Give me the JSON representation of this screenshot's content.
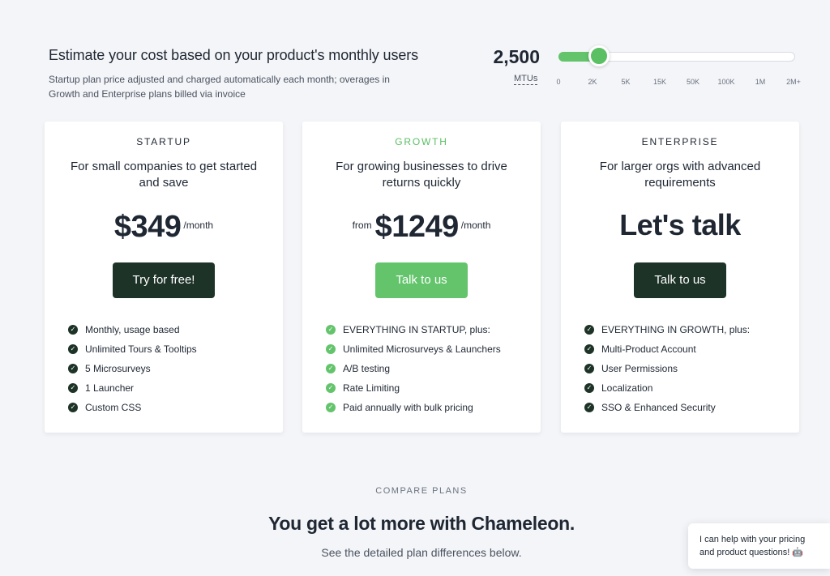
{
  "estimator": {
    "title": "Estimate your cost based on your product's monthly users",
    "subtitle": "Startup plan price adjusted and charged automatically each month; overages in Growth and Enterprise plans billed via invoice",
    "mtu_value": "2,500",
    "mtu_unit": "MTUs",
    "slider_fraction": 0.17,
    "ticks": [
      "0",
      "2K",
      "5K",
      "15K",
      "50K",
      "100K",
      "1M",
      "2M+"
    ]
  },
  "plans": [
    {
      "name": "STARTUP",
      "description": "For small companies to get started and save",
      "price_prefix": "",
      "price": "$349",
      "price_suffix": "/month",
      "cta": "Try for free!",
      "features": [
        "Monthly, usage based",
        "Unlimited Tours & Tooltips",
        "5 Microsurveys",
        "1 Launcher",
        "Custom CSS"
      ]
    },
    {
      "name": "GROWTH",
      "description": "For growing businesses to drive returns quickly",
      "price_prefix": "from",
      "price": "$1249",
      "price_suffix": "/month",
      "cta": "Talk to us",
      "features": [
        "EVERYTHING IN STARTUP, plus:",
        "Unlimited Microsurveys & Launchers",
        "A/B testing",
        "Rate Limiting",
        "Paid annually with bulk pricing"
      ]
    },
    {
      "name": "ENTERPRISE",
      "description": "For larger orgs with advanced requirements",
      "price": "Let's talk",
      "cta": "Talk to us",
      "features": [
        "EVERYTHING IN GROWTH, plus:",
        "Multi-Product Account",
        "User Permissions",
        "Localization",
        "SSO & Enhanced Security"
      ]
    }
  ],
  "compare": {
    "label": "COMPARE PLANS",
    "title": "You get a lot more with Chameleon.",
    "subtitle": "See the detailed plan differences below."
  },
  "chat": {
    "line1": "I can help with your pricing",
    "line2": "and product questions! 🤖"
  },
  "colors": {
    "accent_green": "#63c46c",
    "dark_button": "#1e3328",
    "background": "#f4f5f8"
  }
}
